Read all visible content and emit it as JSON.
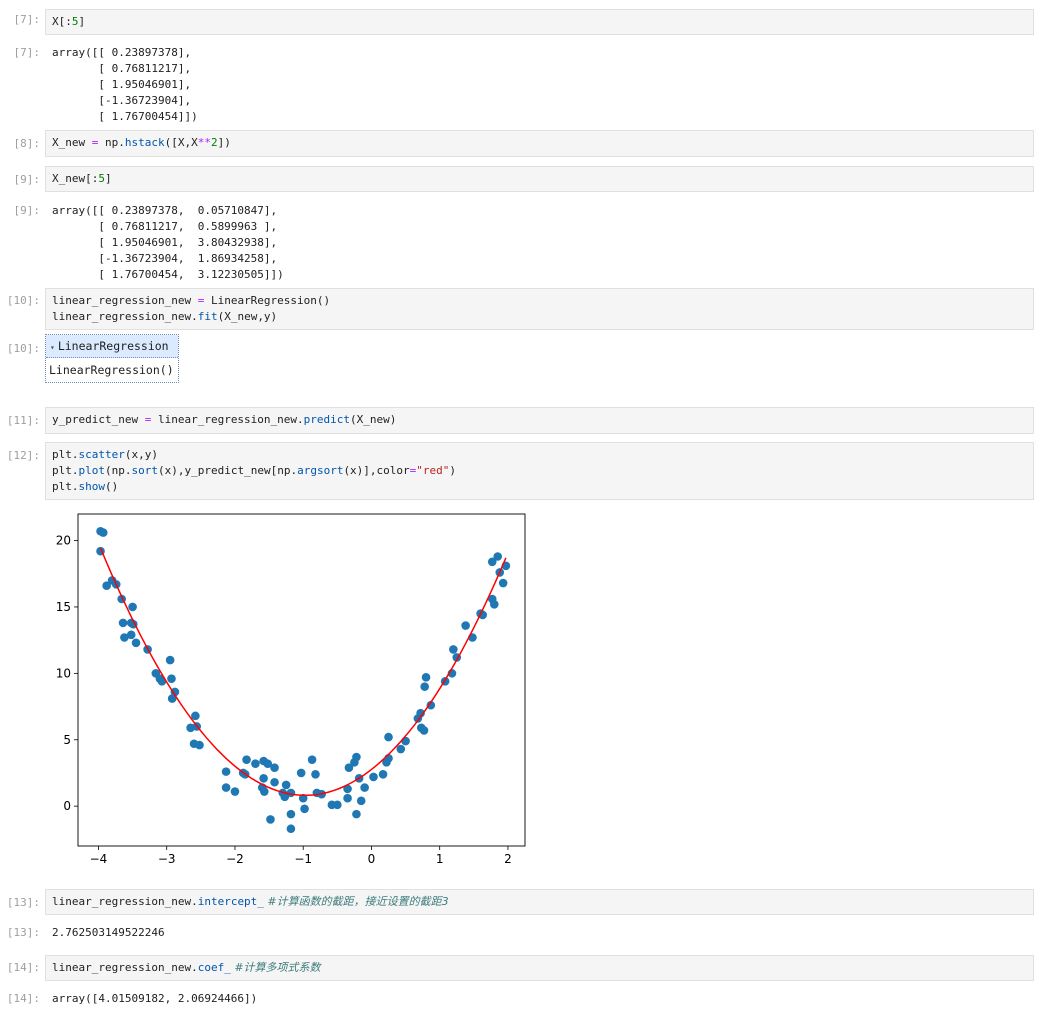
{
  "cells": {
    "c7": {
      "in_prompt": "[7]:",
      "out_prompt": "[7]:",
      "code": {
        "a": "X",
        "b": "[:",
        "c": "5",
        "d": "]"
      },
      "output": [
        "array([[ 0.23897378],",
        "       [ 0.76811217],",
        "       [ 1.95046901],",
        "       [-1.36723904],",
        "       [ 1.76700454]])"
      ]
    },
    "c8": {
      "in_prompt": "[8]:",
      "code": {
        "a": "X_new ",
        "eq": "=",
        "b": " np.",
        "fn": "hstack",
        "c": "([X,X",
        "op": "**",
        "n": "2",
        "d": "])"
      }
    },
    "c9": {
      "in_prompt": "[9]:",
      "out_prompt": "[9]:",
      "code": {
        "a": "X_new",
        "b": "[:",
        "c": "5",
        "d": "]"
      },
      "output": [
        "array([[ 0.23897378,  0.05710847],",
        "       [ 0.76811217,  0.5899963 ],",
        "       [ 1.95046901,  3.80432938],",
        "       [-1.36723904,  1.86934258],",
        "       [ 1.76700454,  3.12230505]])"
      ]
    },
    "c10": {
      "in_prompt": "[10]:",
      "out_prompt": "[10]:",
      "line1": {
        "a": "linear_regression_new ",
        "eq": "=",
        "b": " LinearRegression()"
      },
      "line2": {
        "a": "linear_regression_new.",
        "fn": "fit",
        "b": "(X_new,y)"
      },
      "estimator_toggle": "▾",
      "estimator_title": "LinearRegression",
      "estimator_repr": "LinearRegression()"
    },
    "c11": {
      "in_prompt": "[11]:",
      "code": {
        "a": "y_predict_new ",
        "eq": "=",
        "b": " linear_regression_new.",
        "fn": "predict",
        "c": "(X_new)"
      }
    },
    "c12": {
      "in_prompt": "[12]:",
      "line1": {
        "a": "plt.",
        "fn": "scatter",
        "b": "(x,y)"
      },
      "line2": {
        "a": "plt.",
        "fn": "plot",
        "b": "(np.",
        "fn2": "sort",
        "c": "(x),y_predict_new[np.",
        "fn3": "argsort",
        "d": "(x)],color",
        "eq": "=",
        "str": "\"red\"",
        "e": ")"
      },
      "line3": {
        "a": "plt.",
        "fn": "show",
        "b": "()"
      }
    },
    "c13": {
      "in_prompt": "[13]:",
      "out_prompt": "[13]:",
      "code": {
        "a": "linear_regression_new.",
        "attr": "intercept_",
        "cm": " #计算函数的截距，接近设置的截距3"
      },
      "output": "2.762503149522246"
    },
    "c14": {
      "in_prompt": "[14]:",
      "out_prompt": "[14]:",
      "code": {
        "a": "linear_regression_new.",
        "attr": "coef_",
        "cm": " #计算多项式系数"
      },
      "output": "array([4.01509182, 2.06924466])"
    }
  },
  "chart_data": {
    "type": "scatter",
    "xlim": [
      -4.3,
      2.25
    ],
    "ylim": [
      -3.0,
      22.0
    ],
    "xticks": [
      -4,
      -3,
      -2,
      -1,
      0,
      1,
      2
    ],
    "yticks": [
      0,
      5,
      10,
      15,
      20
    ],
    "xtick_labels": [
      "−4",
      "−3",
      "−2",
      "−1",
      "0",
      "1",
      "2"
    ],
    "ytick_labels": [
      "0",
      "5",
      "10",
      "15",
      "20"
    ],
    "scatter_color": "#1f77b4",
    "line_color": "#ff0000",
    "grid": false,
    "points": [
      [
        -3.97,
        20.7
      ],
      [
        -3.93,
        20.6
      ],
      [
        -3.97,
        19.2
      ],
      [
        -3.88,
        16.6
      ],
      [
        -3.8,
        17.0
      ],
      [
        -3.74,
        16.7
      ],
      [
        -3.66,
        15.6
      ],
      [
        -3.5,
        15.0
      ],
      [
        -3.52,
        13.8
      ],
      [
        -3.49,
        13.7
      ],
      [
        -3.64,
        13.8
      ],
      [
        -3.62,
        12.7
      ],
      [
        -3.52,
        12.9
      ],
      [
        -3.45,
        12.3
      ],
      [
        -3.28,
        11.8
      ],
      [
        -2.95,
        11.0
      ],
      [
        -3.16,
        10.0
      ],
      [
        -3.1,
        9.6
      ],
      [
        -3.07,
        9.4
      ],
      [
        -2.93,
        9.6
      ],
      [
        -2.88,
        8.6
      ],
      [
        -2.92,
        8.1
      ],
      [
        -2.58,
        6.8
      ],
      [
        -2.65,
        5.9
      ],
      [
        -2.56,
        6.0
      ],
      [
        -2.6,
        4.7
      ],
      [
        -2.52,
        4.6
      ],
      [
        -2.13,
        2.6
      ],
      [
        -2.13,
        1.4
      ],
      [
        -2.0,
        1.1
      ],
      [
        -1.88,
        2.5
      ],
      [
        -1.85,
        2.4
      ],
      [
        -1.83,
        3.5
      ],
      [
        -1.7,
        3.2
      ],
      [
        -1.58,
        3.4
      ],
      [
        -1.52,
        3.2
      ],
      [
        -1.58,
        2.1
      ],
      [
        -1.6,
        1.4
      ],
      [
        -1.57,
        1.1
      ],
      [
        -1.42,
        2.9
      ],
      [
        -1.42,
        1.8
      ],
      [
        -1.25,
        1.6
      ],
      [
        -1.3,
        1.0
      ],
      [
        -1.27,
        0.7
      ],
      [
        -1.18,
        1.0
      ],
      [
        -1.18,
        -0.6
      ],
      [
        -1.18,
        -1.7
      ],
      [
        -1.48,
        -1.0
      ],
      [
        -1.03,
        2.5
      ],
      [
        -1.0,
        0.6
      ],
      [
        -0.98,
        -0.2
      ],
      [
        -0.87,
        3.5
      ],
      [
        -0.82,
        2.4
      ],
      [
        -0.8,
        1.0
      ],
      [
        -0.73,
        0.9
      ],
      [
        -0.58,
        0.1
      ],
      [
        -0.5,
        0.1
      ],
      [
        -0.35,
        1.3
      ],
      [
        -0.35,
        0.6
      ],
      [
        -0.33,
        2.9
      ],
      [
        -0.25,
        3.3
      ],
      [
        -0.22,
        3.7
      ],
      [
        -0.18,
        2.1
      ],
      [
        -0.22,
        -0.6
      ],
      [
        -0.15,
        0.4
      ],
      [
        -0.1,
        1.4
      ],
      [
        0.03,
        2.2
      ],
      [
        0.17,
        2.4
      ],
      [
        0.22,
        3.3
      ],
      [
        0.25,
        3.6
      ],
      [
        0.25,
        5.2
      ],
      [
        0.43,
        4.3
      ],
      [
        0.5,
        4.9
      ],
      [
        0.68,
        6.6
      ],
      [
        0.72,
        7.0
      ],
      [
        0.73,
        5.9
      ],
      [
        0.77,
        5.7
      ],
      [
        0.78,
        9.0
      ],
      [
        0.8,
        9.7
      ],
      [
        0.87,
        7.6
      ],
      [
        1.08,
        9.4
      ],
      [
        1.18,
        10.0
      ],
      [
        1.2,
        11.8
      ],
      [
        1.25,
        11.2
      ],
      [
        1.38,
        13.6
      ],
      [
        1.48,
        12.7
      ],
      [
        1.6,
        14.5
      ],
      [
        1.63,
        14.4
      ],
      [
        1.77,
        15.6
      ],
      [
        1.8,
        15.2
      ],
      [
        1.77,
        18.4
      ],
      [
        1.85,
        18.8
      ],
      [
        1.88,
        17.6
      ],
      [
        1.93,
        16.8
      ],
      [
        1.97,
        18.1
      ]
    ],
    "fit_curve": {
      "intercept": 2.762503149522246,
      "coef": [
        4.01509182,
        2.06924466
      ],
      "x_range": [
        -3.97,
        1.97
      ]
    }
  }
}
